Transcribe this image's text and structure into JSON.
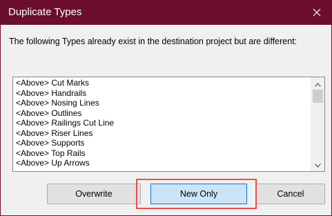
{
  "dialog": {
    "title": "Duplicate Types",
    "close_icon": "close-icon",
    "message": "The following Types already exist in the destination project but are different:"
  },
  "list": {
    "items": [
      "<Above> Cut Marks",
      "<Above> Handrails",
      "<Above> Nosing Lines",
      "<Above> Outlines",
      "<Above> Railings Cut Line",
      "<Above> Riser Lines",
      "<Above> Supports",
      "<Above> Top Rails",
      "<Above> Up Arrows"
    ],
    "scroll_up_icon": "chevron-up-icon",
    "scroll_down_icon": "chevron-down-icon"
  },
  "buttons": {
    "overwrite": "Overwrite",
    "new_only": "New Only",
    "cancel": "Cancel"
  },
  "colors": {
    "titlebar": "#6b0e2f",
    "highlight": "#e8504f",
    "focused_button": "#cce4f7"
  }
}
